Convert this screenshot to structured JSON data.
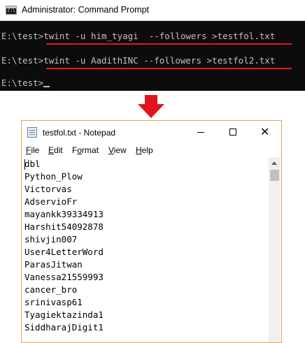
{
  "cmd": {
    "title": "Administrator: Command Prompt",
    "icon_text": "C:\\",
    "lines": [
      {
        "prompt": "E:\\test>",
        "command": "twint -u him_tyagi  --followers >testfol.txt"
      },
      {
        "prompt": "E:\\test>",
        "command": "twint -u AadithINC --followers >testfol2.txt"
      },
      {
        "prompt": "E:\\test>",
        "command": ""
      }
    ],
    "highlight_color": "#e0161c"
  },
  "arrow": {
    "color": "#e0161c",
    "icon": "down-arrow-icon"
  },
  "notepad": {
    "title": "testfol.txt - Notepad",
    "controls": {
      "minimize": "minimize-icon",
      "maximize": "maximize-icon",
      "close": "✕"
    },
    "menu": [
      {
        "label": "File",
        "key": "F"
      },
      {
        "label": "Edit",
        "key": "E"
      },
      {
        "label": "Format",
        "key": "o"
      },
      {
        "label": "View",
        "key": "V"
      },
      {
        "label": "Help",
        "key": "H"
      }
    ],
    "lines": [
      "dbl",
      "Python_Plow",
      "Victorvas",
      "AdservioFr",
      "mayankk39334913",
      "Harshit54092878",
      "shivjin007",
      "User4LetterWord",
      "ParasJitwan",
      "Vanessa21559993",
      "cancer_bro",
      "srinivasp61",
      "Tyagiektazinda1",
      "SiddharajDigit1"
    ]
  }
}
